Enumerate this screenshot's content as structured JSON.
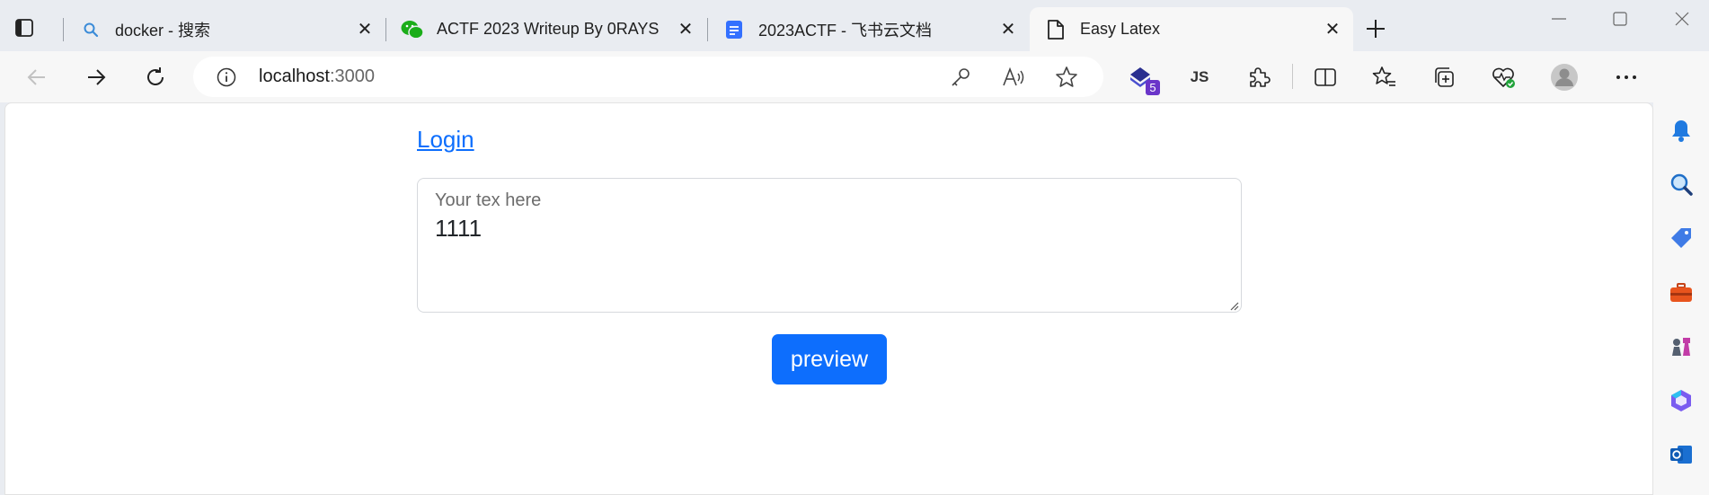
{
  "tabs": [
    {
      "title": "docker - 搜索",
      "favicon": "search-icon",
      "active": false
    },
    {
      "title": "ACTF 2023 Writeup By 0RAYS",
      "favicon": "wechat-icon",
      "active": false
    },
    {
      "title": "2023ACTF - 飞书云文档",
      "favicon": "document-icon",
      "active": false
    },
    {
      "title": "Easy Latex",
      "favicon": "page-icon",
      "active": true
    }
  ],
  "address_bar": {
    "host": "localhost",
    "port": ":3000"
  },
  "extensions": {
    "badge_count": "5",
    "js_label": "JS"
  },
  "page": {
    "login_label": "Login",
    "tex_label": "Your tex here",
    "tex_value": "1111",
    "preview_label": "preview"
  },
  "colors": {
    "accent": "#0d6efd",
    "tabstrip_bg": "#e9ecf1",
    "toolbar_bg": "#f7f7f7",
    "badge": "#6a35c9"
  }
}
